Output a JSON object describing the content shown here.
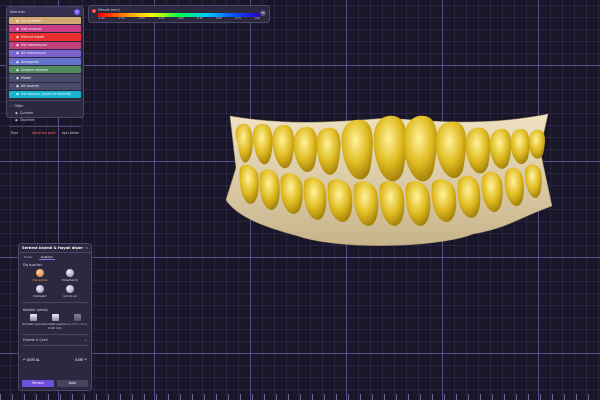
{
  "app": {
    "accent": "#7a5cff"
  },
  "scene_tree": {
    "title": "Nesneler",
    "add_icon": "plus-icon",
    "items": [
      {
        "label": "Üst anatomi",
        "color": "#d2a872"
      },
      {
        "label": "Sağ anatomi",
        "color": "#c73d88"
      },
      {
        "label": "Mevcut model",
        "color": "#e83030"
      },
      {
        "label": "Üst restorasyon",
        "color": "#c23f7c"
      },
      {
        "label": "Alt restorasyon",
        "color": "#7a62cc"
      },
      {
        "label": "Antagonist",
        "color": "#6473c9"
      },
      {
        "label": "Gingiva maskesi",
        "color": "#4f8b5c"
      },
      {
        "label": "Model",
        "color": "#4a4a6a"
      },
      {
        "label": "Alt tasarım",
        "color": "#4a4a6a"
      },
      {
        "label": "Üst tasarım (dişler birleştirildi)",
        "color": "#13b5cf"
      }
    ],
    "other_header": "Diğer",
    "other_items": [
      "Çizimler",
      "Ölçümler"
    ],
    "footer": {
      "left": "Ekol",
      "middle": "Kenarları gizle",
      "right": "Aşırı kaldır"
    }
  },
  "color_scale": {
    "title": "Mesafe (mm)",
    "ticks": [
      "-1.00",
      "-0.75",
      "-0.50",
      "-0.25",
      "0.00",
      "0.25",
      "0.50",
      "0.75",
      "1.00"
    ],
    "menu_icon": "menu-icon"
  },
  "tool_panel": {
    "title": "Serbest biçimli & Hayali dişler",
    "tabs": [
      "Dişler",
      "Anatomi"
    ],
    "section_main": "Diş ayarları",
    "tools": [
      {
        "label": "Diş ayarla",
        "icon": "tooth-adjust-icon",
        "active": true
      },
      {
        "label": "Ekle/Kaldır",
        "icon": "add-remove-icon",
        "active": false
      },
      {
        "label": "Düzleştir",
        "icon": "smooth-icon",
        "active": false
      },
      {
        "label": "Çıkıntı sil",
        "icon": "bump-remove-icon",
        "active": false
      }
    ],
    "section_contacts": "Kontakt (ortak)",
    "contact_tools": [
      {
        "label": "Kontakt ayarla",
        "icon": "contact-set-icon",
        "dim": false
      },
      {
        "label": "Kontakt ayarla 0.00 mm",
        "icon": "contact-gap-icon",
        "dim": false
      },
      {
        "label": "Kontakt sıfırla",
        "icon": "contact-reset-icon",
        "dim": true
      }
    ],
    "expander": "Frezele & Çevir",
    "step_left": "↶ GERİ AL",
    "step_right": "İLERİ ↷",
    "ok": "Tamam",
    "cancel": "İptal"
  }
}
